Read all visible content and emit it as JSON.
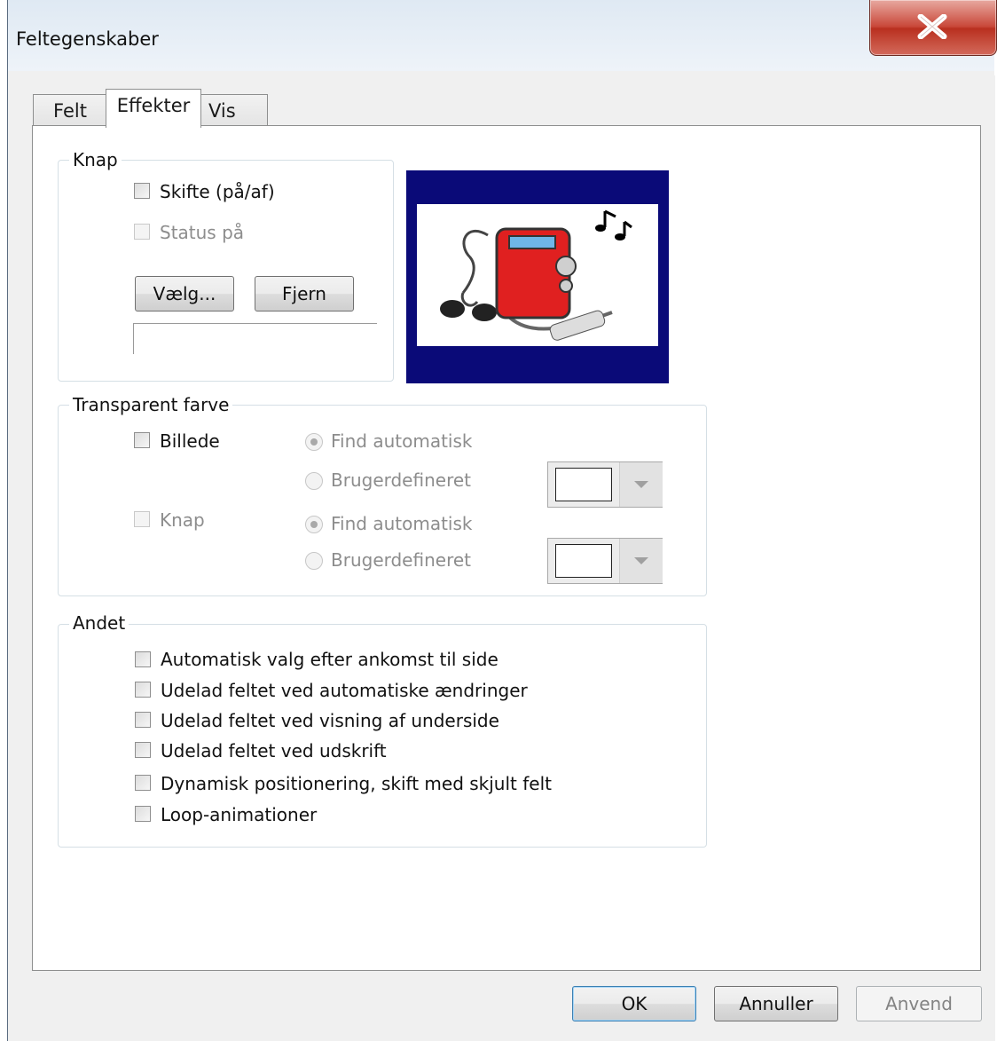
{
  "window": {
    "title": "Feltegenskaber"
  },
  "tabs": [
    {
      "label": "Felt",
      "active": false
    },
    {
      "label": "Effekter",
      "active": true
    },
    {
      "label": "Vis",
      "active": false
    }
  ],
  "knap_group": {
    "legend": "Knap",
    "toggle_label": "Skifte (på/af)",
    "status_label": "Status på",
    "choose_button": "Vælg...",
    "remove_button": "Fjern",
    "file_path": ""
  },
  "transparent_group": {
    "legend": "Transparent farve",
    "billede_label": "Billede",
    "knap_label": "Knap",
    "auto_label": "Find automatisk",
    "custom_label": "Brugerdefineret",
    "swatch_color": "#ffffff"
  },
  "andet_group": {
    "legend": "Andet",
    "options": [
      "Automatisk valg efter ankomst til side",
      "Udelad feltet ved automatiske ændringer",
      "Udelad feltet ved visning af underside",
      "Udelad feltet ved udskrift",
      "Dynamisk positionering, skift med skjult felt",
      "Loop-animationer"
    ]
  },
  "footer": {
    "ok": "OK",
    "cancel": "Annuller",
    "apply": "Anvend"
  },
  "colors": {
    "preview_background": "#0a0a78",
    "player_red": "#e02020",
    "close_red": "#c9483a"
  }
}
